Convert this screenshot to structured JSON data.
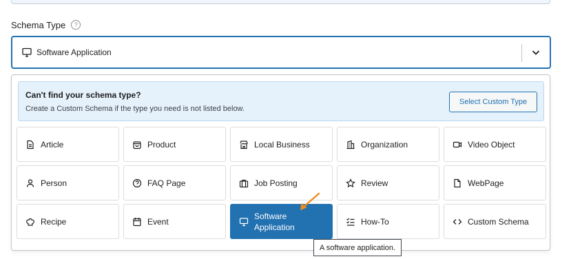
{
  "field": {
    "label": "Schema Type",
    "help_icon": "?"
  },
  "select": {
    "value": "Software Application",
    "icon": "monitor-icon"
  },
  "notice": {
    "title": "Can't find your schema type?",
    "description": "Create a Custom Schema if the type you need is not listed below.",
    "button_label": "Select Custom Type"
  },
  "schema_types": [
    {
      "label": "Article",
      "icon": "document-icon"
    },
    {
      "label": "Product",
      "icon": "bag-icon"
    },
    {
      "label": "Local Business",
      "icon": "store-icon"
    },
    {
      "label": "Organization",
      "icon": "building-icon"
    },
    {
      "label": "Video Object",
      "icon": "video-icon"
    },
    {
      "label": "Person",
      "icon": "person-icon"
    },
    {
      "label": "FAQ Page",
      "icon": "question-icon"
    },
    {
      "label": "Job Posting",
      "icon": "briefcase-icon"
    },
    {
      "label": "Review",
      "icon": "star-icon"
    },
    {
      "label": "WebPage",
      "icon": "page-icon"
    },
    {
      "label": "Recipe",
      "icon": "chef-hat-icon"
    },
    {
      "label": "Event",
      "icon": "calendar-icon"
    },
    {
      "label": "Software Application",
      "icon": "monitor-icon",
      "selected": true
    },
    {
      "label": "How-To",
      "icon": "checklist-icon"
    },
    {
      "label": "Custom Schema",
      "icon": "code-icon"
    }
  ],
  "tooltip": "A software application.",
  "colors": {
    "accent": "#2271b1",
    "annotation_arrow": "#f08c1e",
    "notice_bg": "#e5f1fb"
  }
}
